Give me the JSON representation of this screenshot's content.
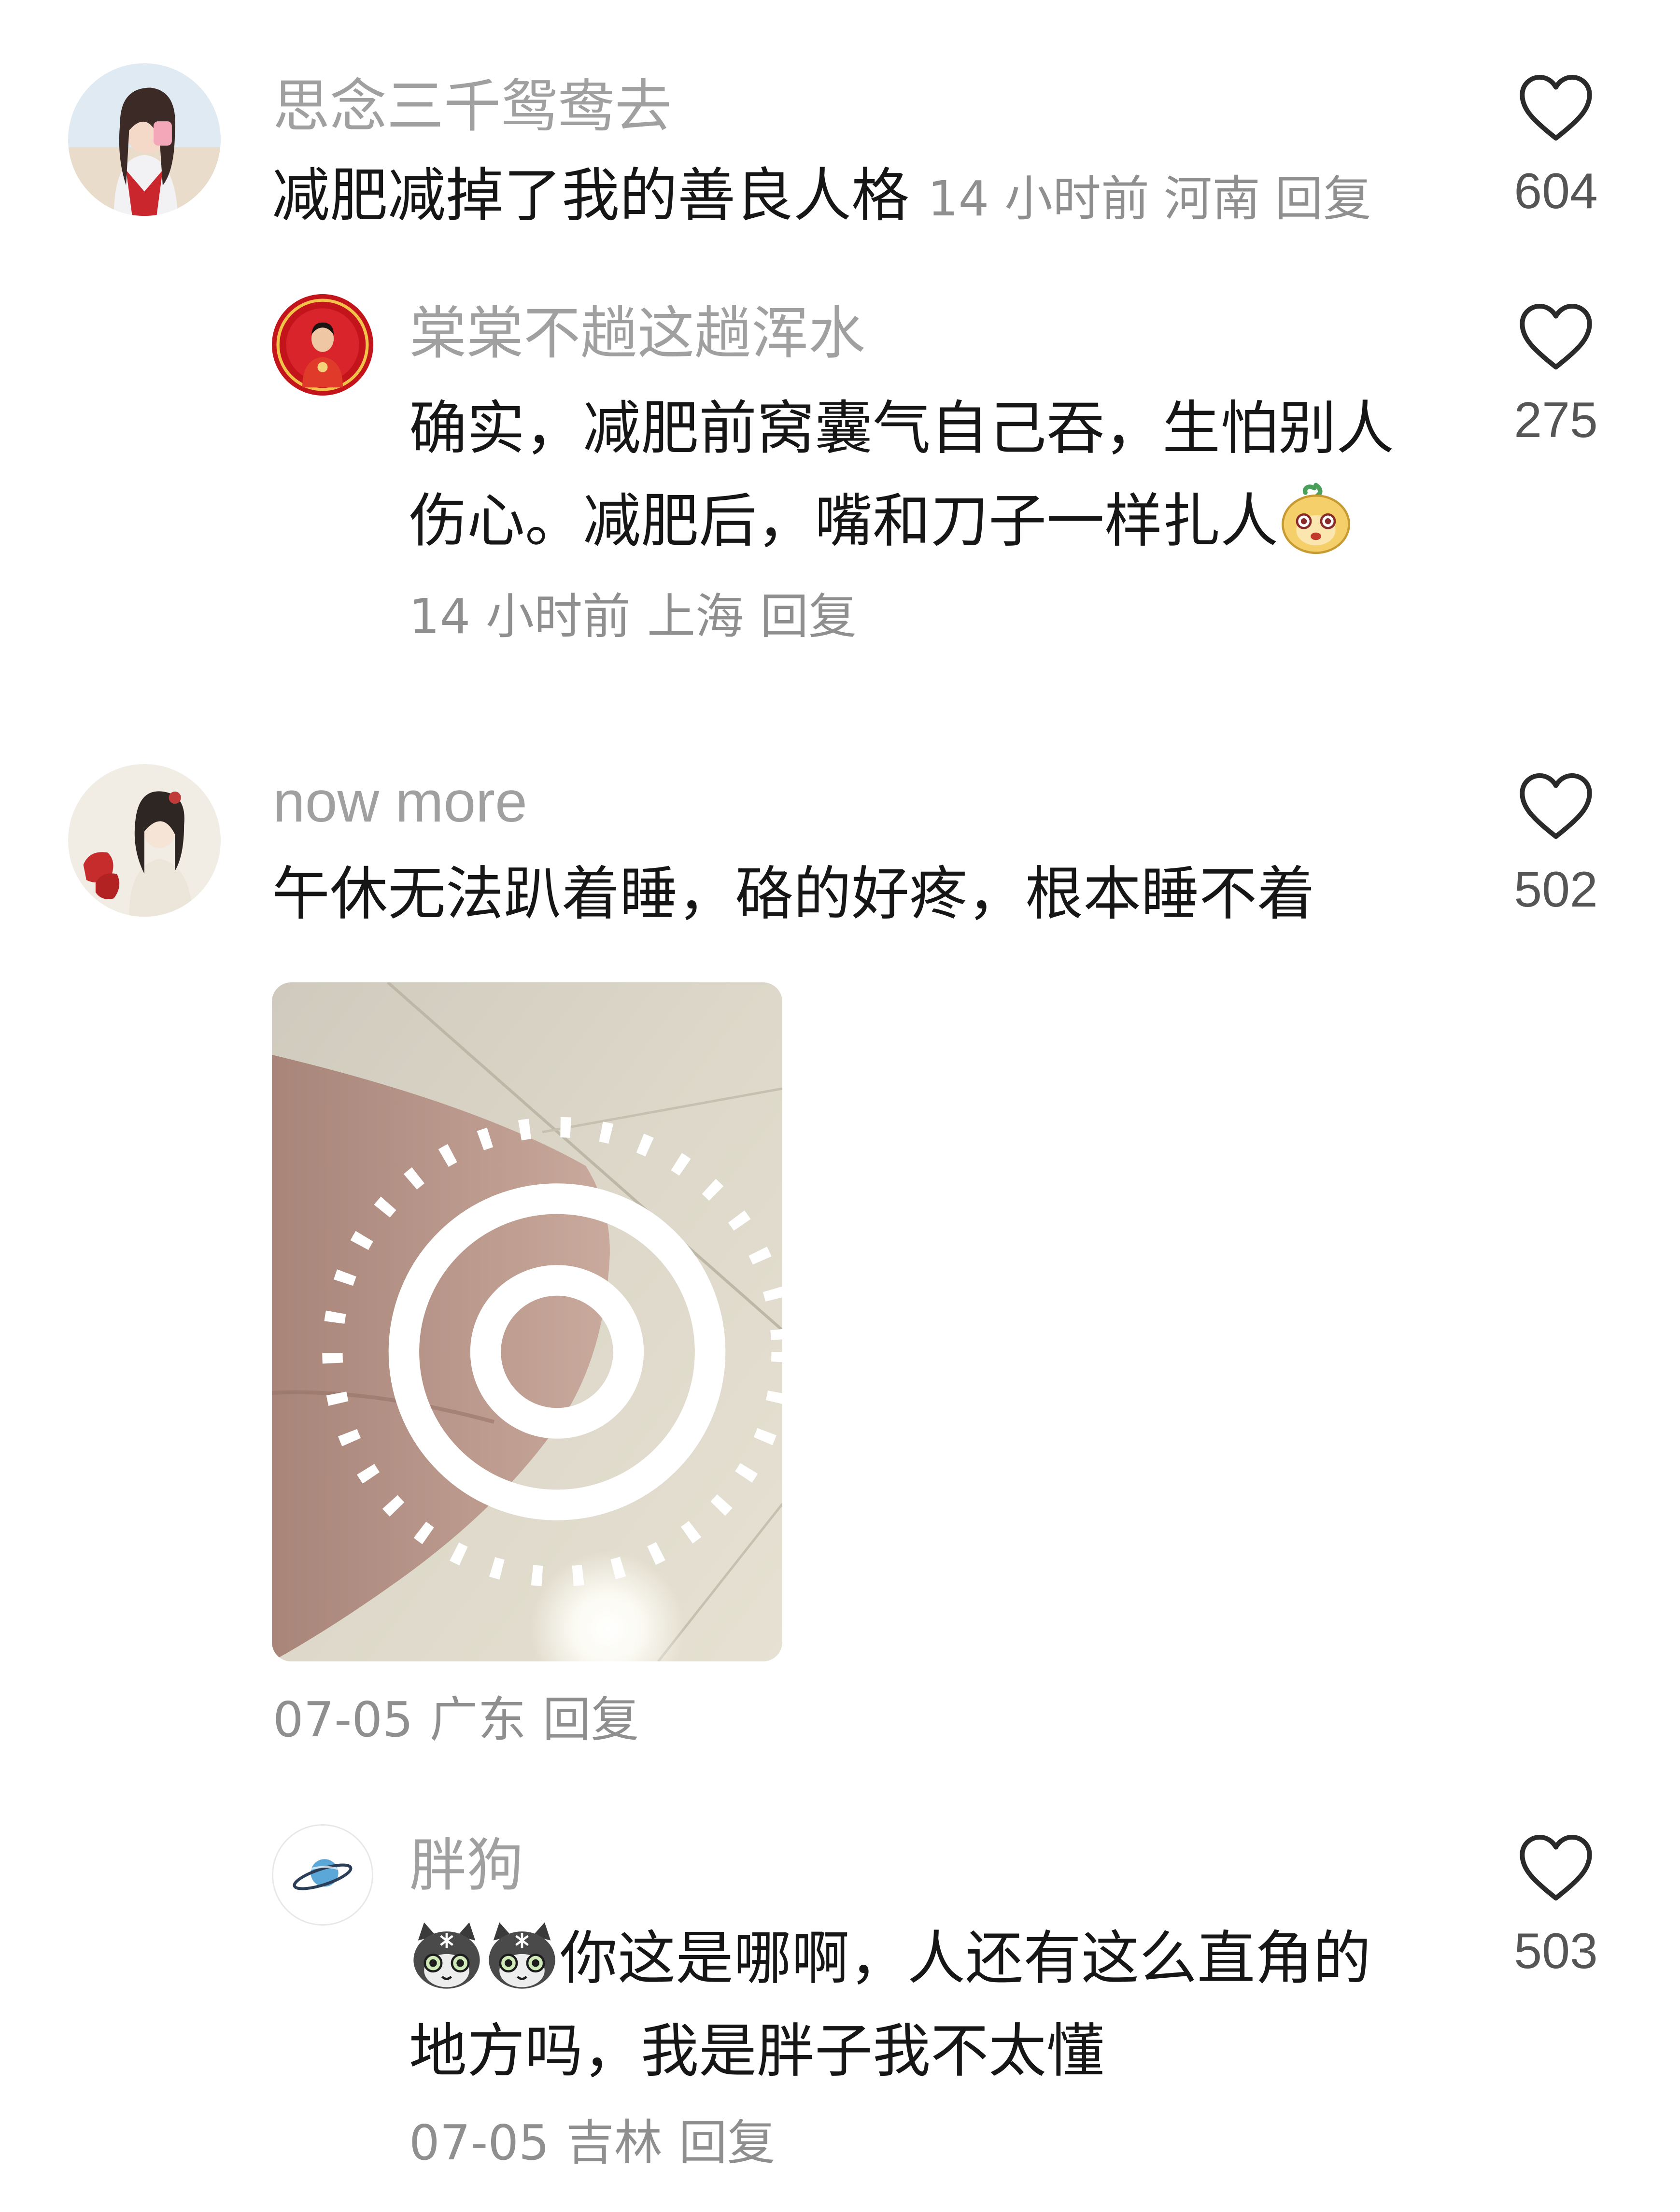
{
  "comments": [
    {
      "username": "思念三千鸳鸯去",
      "text": "减肥减掉了我的善良人格",
      "time": "14 小时前",
      "location": "河南",
      "reply": "回复",
      "likes": "604",
      "replies": [
        {
          "username": "棠棠不趟这趟浑水",
          "text_line1": "确实，减肥前窝囊气自己吞，生怕别人",
          "text_line2": "伤心。减肥后，嘴和刀子一样扎人",
          "emoji": "face-emoji-icon",
          "time": "14 小时前",
          "location": "上海",
          "reply": "回复",
          "likes": "275"
        }
      ]
    },
    {
      "username": "now more",
      "text": "午休无法趴着睡，硌的好疼，根本睡不着",
      "image": "elbow-photo",
      "time": "07-05",
      "location": "广东",
      "reply": "回复",
      "likes": "502",
      "replies": [
        {
          "username": "胖狗",
          "emoji": "cat-emoji-icon",
          "text_line1": "你这是哪啊，人还有这么直角的",
          "text_line2": "地方吗，我是胖子我不太懂",
          "time": "07-05",
          "location": "吉林",
          "reply": "回复",
          "likes": "503"
        }
      ]
    }
  ],
  "colors": {
    "username": "#a0a0a0",
    "content": "#161616",
    "meta": "#8f8f8f",
    "heart": "#2a2a2a"
  }
}
